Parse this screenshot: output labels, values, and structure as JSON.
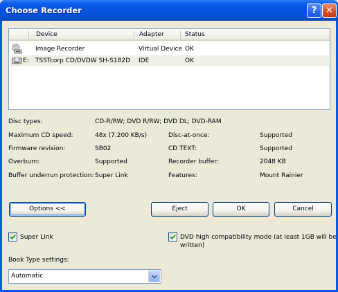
{
  "window": {
    "title": "Choose Recorder",
    "help_glyph": "?",
    "close_glyph": "✕"
  },
  "device_list": {
    "columns": [
      "Device",
      "Adapter",
      "Status"
    ],
    "rows": [
      {
        "drive": "",
        "device": "Image Recorder",
        "adapter": "Virtual Device",
        "status": "OK",
        "icon": "image-recorder-icon"
      },
      {
        "drive": "E:",
        "device": "TSSTcorp CD/DVDW SH-S182D",
        "adapter": "IDE",
        "status": "OK",
        "icon": "optical-drive-icon"
      }
    ]
  },
  "properties": {
    "disc_types_label": "Disc types:",
    "disc_types_value": "CD-R/RW; DVD R/RW; DVD DL; DVD-RAM",
    "max_cd_speed_label": "Maximum CD speed:",
    "max_cd_speed_value": "48x (7.200 KB/s)",
    "disc_at_once_label": "Disc-at-once:",
    "disc_at_once_value": "Supported",
    "firmware_label": "Firmware revision:",
    "firmware_value": "SB02",
    "cd_text_label": "CD TEXT:",
    "cd_text_value": "Supported",
    "overburn_label": "Overburn:",
    "overburn_value": "Supported",
    "recorder_buffer_label": "Recorder buffer:",
    "recorder_buffer_value": "2048 KB",
    "buffer_underrun_label": "Buffer underrun protection:",
    "buffer_underrun_value": "Super Link",
    "features_label": "Features:",
    "features_value": "Mount Rainier"
  },
  "buttons": {
    "options": "Options <<",
    "eject": "Eject",
    "ok": "OK",
    "cancel": "Cancel"
  },
  "options": {
    "super_link_label": "Super Link",
    "super_link_checked": true,
    "dvd_compat_label_line1": "DVD high compatibility mode (at least 1GB will be",
    "dvd_compat_label_line2": "written)",
    "dvd_compat_checked": true,
    "book_type_label": "Book Type settings:",
    "book_type_value": "Automatic"
  }
}
